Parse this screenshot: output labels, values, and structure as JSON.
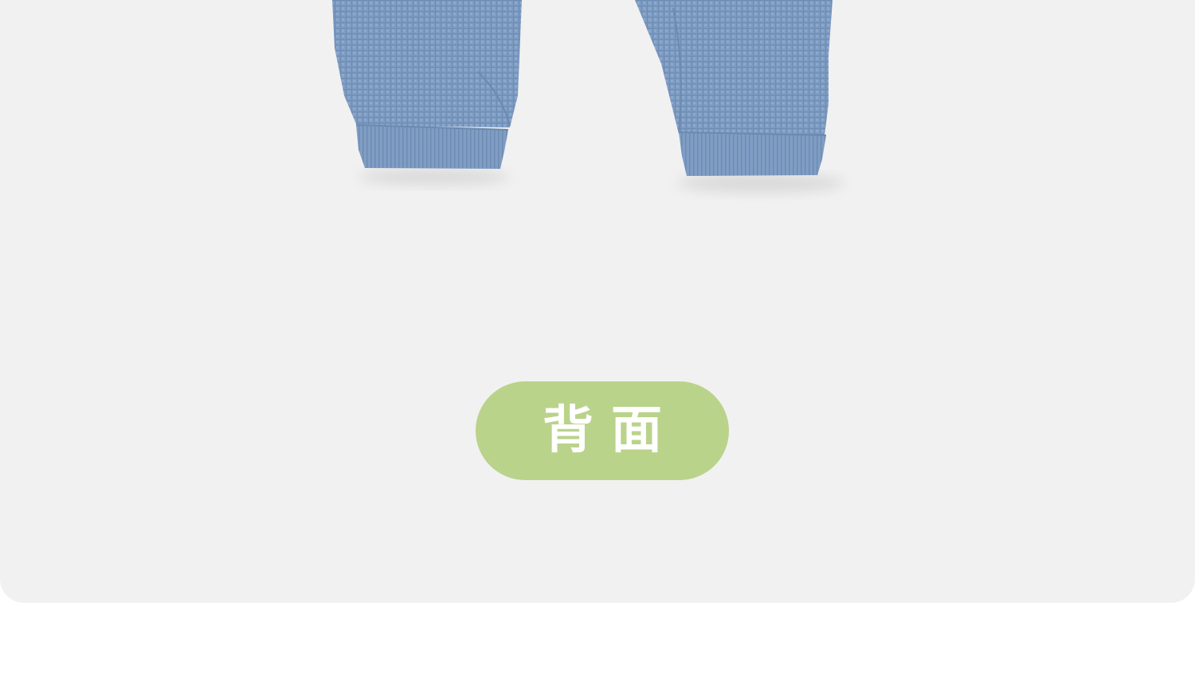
{
  "label": {
    "text": "背面"
  },
  "garment": {
    "icon": "pants-cuffs-image"
  },
  "colors": {
    "card_background": "#f1f1f1",
    "page_background": "#ffffff",
    "pill_background": "#bad38a",
    "pill_text": "#ffffff",
    "fabric": "#7f9dc3"
  }
}
